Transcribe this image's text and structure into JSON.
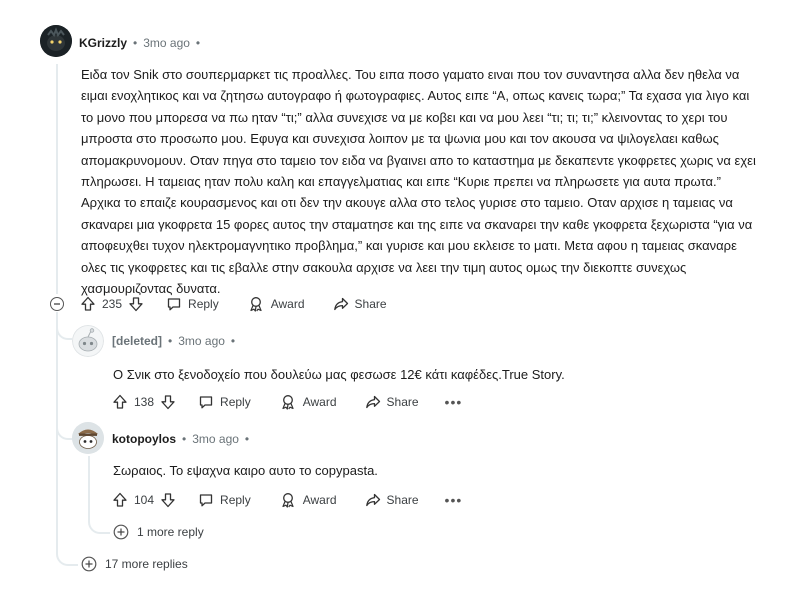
{
  "comments": [
    {
      "author": "KGrizzly",
      "time": "3mo ago",
      "dot": "•",
      "body": "Ειδα τον Snik στο σουπερμαρκετ τις προαλλες. Του ειπα ποσο γαματο ειναι που τον συναντησα αλλα δεν ηθελα να ειμαι ενοχλητικος και να ζητησω αυτογραφο ή φωτογραφιες. Αυτος ειπε “Α, οπως κανεις τωρα;” Τα εχασα για λιγο και το μονο που μπορεσα να πω ηταν “τι;” αλλα συνεχισε να με κοβει και να μου λεει “τι; τι; τι;” κλεινοντας το χερι του μπροστα στο προσωπο μου. Εφυγα και συνεχισα λοιπον με τα ψωνια μου και τον ακουσα να ψιλογελαει καθως απομακρυνομουν. Οταν πηγα στο ταμειο τον ειδα να βγαινει απο το καταστημα με δεκαπεντε γκοφρετες χωρις να εχει πληρωσει. Η ταμειας ηταν πολυ καλη και επαγγελματιας και ειπε “Κυριε πρεπει να πληρωσετε για αυτα πρωτα.” Αρχικα το επαιζε κουρασμενος και οτι δεν την ακουγε αλλα στο τελος γυρισε στο ταμειο. Οταν αρχισε η ταμειας να σκαναρει μια γκοφρετα 15 φορες αυτος την σταματησε και της ειπε να σκαναρει την καθε γκοφρετα ξεχωριστα “για να αποφευχθει τυχον ηλεκτρομαγνητικο προβλημα,” και γυρισε και μου εκλεισε το ματι. Μετα αφου η ταμειας σκαναρε ολες τις γκοφρετες και τις εβαλλε στην σακουλα αρχισε να λεει την τιμη αυτος ομως την διεκοπτε συνεχως χασμουριζοντας δυνατα.",
      "votes": "235"
    },
    {
      "author": "[deleted]",
      "time": "3mo ago",
      "dot": "•",
      "body": "Ο Σνικ στο ξενοδοχείο που δουλεύω μας φεσωσε 12€ κάτι καφέδες.True Story.",
      "votes": "138"
    },
    {
      "author": "kotopoylos",
      "time": "3mo ago",
      "dot": "•",
      "body": "Σωραιος. Το εψαχνα καιρο αυτο το copypasta.",
      "votes": "104"
    }
  ],
  "actions": {
    "reply": "Reply",
    "award": "Award",
    "share": "Share",
    "more": "•••"
  },
  "more_replies_nested": "1 more reply",
  "more_replies_top": "17 more replies",
  "colors": {
    "text": "#1c1c1c",
    "meta": "#6a7378",
    "line": "#e5ebee"
  },
  "icons": [
    "upvote-icon",
    "downvote-icon",
    "reply-icon",
    "award-icon",
    "share-icon",
    "plus-circle-icon",
    "minus-circle-icon"
  ]
}
